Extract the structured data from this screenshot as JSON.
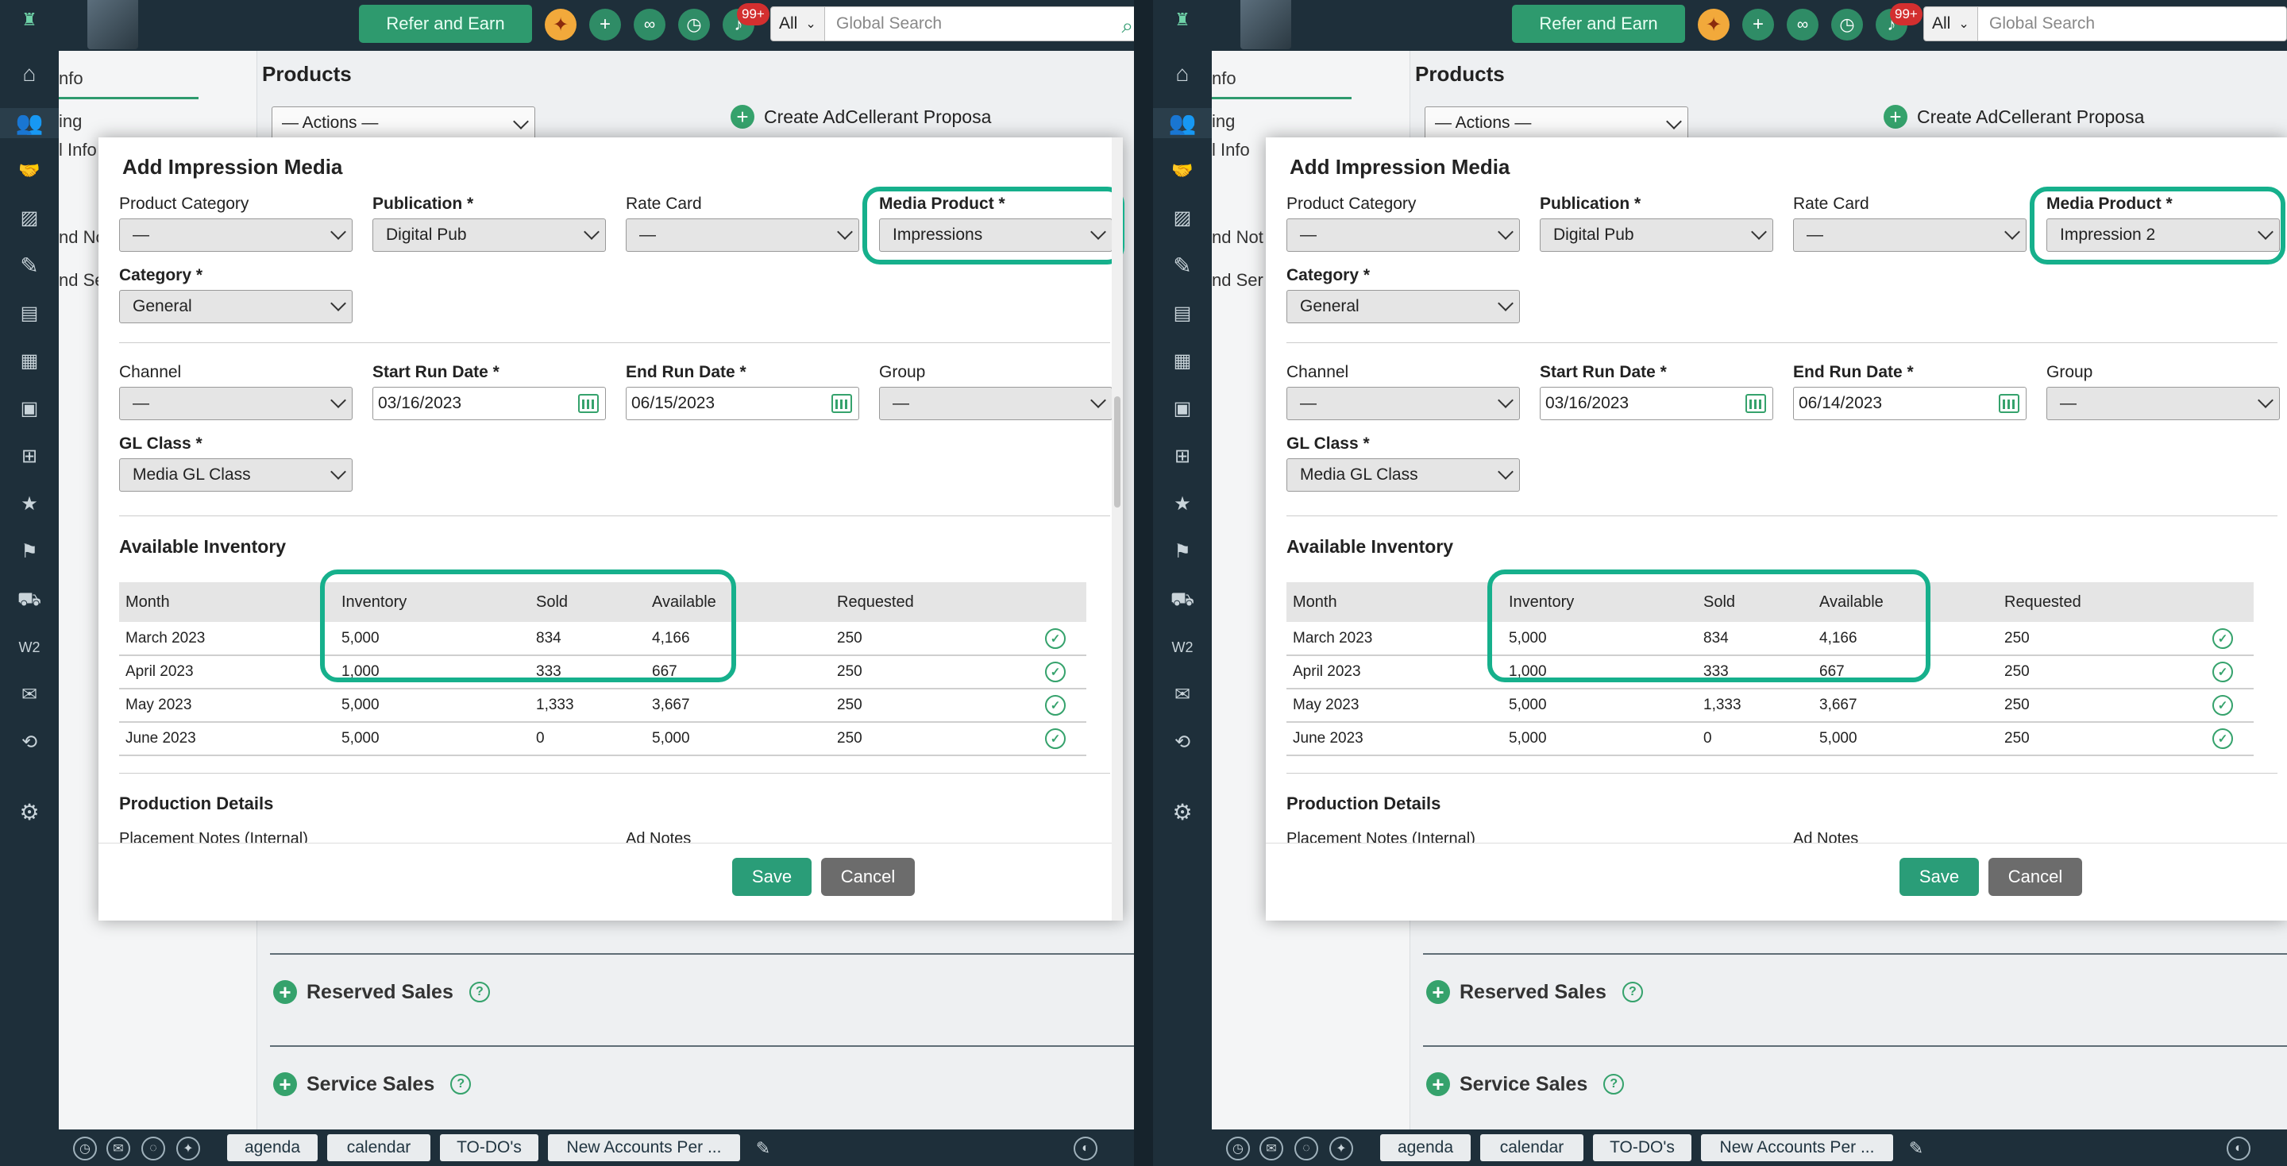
{
  "app": {
    "refer_label": "Refer and Earn",
    "notif_badge": "99+",
    "search_scope": "All",
    "search_placeholder": "Global Search"
  },
  "page": {
    "left_tabs": [
      "nfo",
      "ing",
      "l Info",
      "nd Not",
      "nd Ser"
    ],
    "products_title": "Products",
    "actions_label": "— Actions —",
    "create_proposal": "Create AdCellerant Proposa",
    "reserved_sales": "Reserved Sales",
    "service_sales": "Service Sales"
  },
  "bottom_tabs": [
    "agenda",
    "calendar",
    "TO-DO's",
    "New Accounts Per ..."
  ],
  "modal": {
    "title": "Add Impression Media",
    "labels": {
      "product_category": "Product Category",
      "publication": "Publication *",
      "rate_card": "Rate Card",
      "media_product": "Media Product *",
      "category": "Category *",
      "channel": "Channel",
      "start_run_date": "Start Run Date *",
      "end_run_date": "End Run Date *",
      "group": "Group",
      "gl_class": "GL Class *",
      "available_inventory": "Available Inventory",
      "production_details": "Production Details",
      "placement_notes": "Placement Notes (Internal)",
      "ad_notes": "Ad Notes"
    },
    "columns": [
      "Month",
      "Inventory",
      "Sold",
      "Available",
      "Requested"
    ],
    "save": "Save",
    "cancel": "Cancel"
  },
  "panes": [
    {
      "values": {
        "product_category": "—",
        "publication": "Digital Pub",
        "rate_card": "—",
        "media_product": "Impressions",
        "category": "General",
        "channel": "—",
        "start_run_date": "03/16/2023",
        "end_run_date": "06/15/2023",
        "group": "—",
        "gl_class": "Media GL Class"
      },
      "rows": [
        {
          "month": "March 2023",
          "inventory": "5,000",
          "sold": "834",
          "available": "4,166",
          "requested": "250"
        },
        {
          "month": "April 2023",
          "inventory": "1,000",
          "sold": "333",
          "available": "667",
          "requested": "250"
        },
        {
          "month": "May 2023",
          "inventory": "5,000",
          "sold": "1,333",
          "available": "3,667",
          "requested": "250"
        },
        {
          "month": "June 2023",
          "inventory": "5,000",
          "sold": "0",
          "available": "5,000",
          "requested": "250"
        }
      ]
    },
    {
      "values": {
        "product_category": "—",
        "publication": "Digital Pub",
        "rate_card": "—",
        "media_product": "Impression 2",
        "category": "General",
        "channel": "—",
        "start_run_date": "03/16/2023",
        "end_run_date": "06/14/2023",
        "group": "—",
        "gl_class": "Media GL Class"
      },
      "rows": [
        {
          "month": "March 2023",
          "inventory": "5,000",
          "sold": "834",
          "available": "4,166",
          "requested": "250"
        },
        {
          "month": "April 2023",
          "inventory": "1,000",
          "sold": "333",
          "available": "667",
          "requested": "250"
        },
        {
          "month": "May 2023",
          "inventory": "5,000",
          "sold": "1,333",
          "available": "3,667",
          "requested": "250"
        },
        {
          "month": "June 2023",
          "inventory": "5,000",
          "sold": "0",
          "available": "5,000",
          "requested": "250"
        }
      ]
    }
  ],
  "colors": {
    "nav_bg": "#1e2f3a",
    "accent_green": "#2a9d78",
    "highlight_teal": "#16b08c",
    "cancel_gray": "#6c6c6c"
  },
  "icons": {
    "nav": [
      "home-icon",
      "users-icon",
      "handshake-icon",
      "image-icon",
      "ticket-icon",
      "document-icon",
      "media-icon",
      "clipboard-icon",
      "cart-icon",
      "calendar-star-icon",
      "mailbox-icon",
      "truck-icon",
      "w2-icon",
      "mail-icon",
      "swap-icon",
      "gear-icon"
    ],
    "top": [
      "party-icon",
      "plus-icon",
      "link-icon",
      "clock-icon",
      "bell-icon",
      "search-icon"
    ],
    "row_status": "check-circle-icon"
  }
}
